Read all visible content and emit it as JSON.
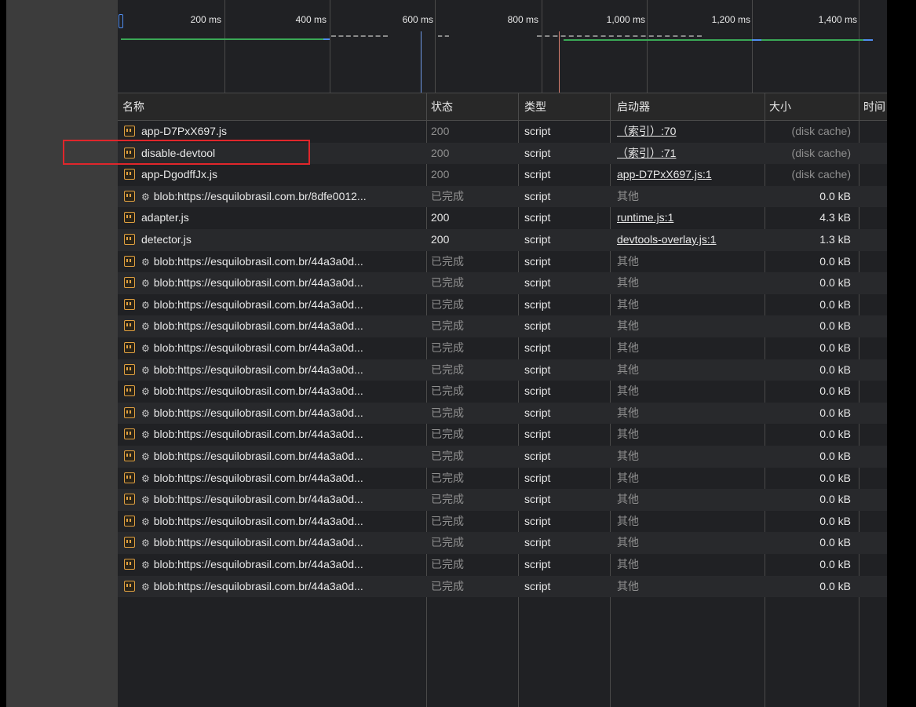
{
  "timeline": {
    "labels": [
      "200 ms",
      "400 ms",
      "600 ms",
      "800 ms",
      "1,000 ms",
      "1,200 ms",
      "1,400 ms"
    ]
  },
  "columns": {
    "name": "名称",
    "status": "状态",
    "type": "类型",
    "initiator": "启动器",
    "size": "大小",
    "time": "时间"
  },
  "rows": [
    {
      "name": "app-D7PxX697.js",
      "blob": false,
      "status": "200",
      "status_dim": true,
      "type": "script",
      "initiator": "（索引）:70",
      "initiator_link": true,
      "size": "(disk cache)",
      "size_dim": true
    },
    {
      "name": "disable-devtool",
      "blob": false,
      "status": "200",
      "status_dim": true,
      "type": "script",
      "initiator": "（索引）:71",
      "initiator_link": true,
      "size": "(disk cache)",
      "size_dim": true
    },
    {
      "name": "app-DgodffJx.js",
      "blob": false,
      "status": "200",
      "status_dim": true,
      "type": "script",
      "initiator": "app-D7PxX697.js:1",
      "initiator_link": true,
      "size": "(disk cache)",
      "size_dim": true
    },
    {
      "name": "blob:https://esquilobrasil.com.br/8dfe0012...",
      "blob": true,
      "status": "已完成",
      "status_dim": true,
      "type": "script",
      "initiator": "其他",
      "initiator_link": false,
      "size": "0.0 kB",
      "size_dim": false
    },
    {
      "name": "adapter.js",
      "blob": false,
      "status": "200",
      "status_dim": false,
      "type": "script",
      "initiator": "runtime.js:1",
      "initiator_link": true,
      "size": "4.3 kB",
      "size_dim": false
    },
    {
      "name": "detector.js",
      "blob": false,
      "status": "200",
      "status_dim": false,
      "type": "script",
      "initiator": "devtools-overlay.js:1",
      "initiator_link": true,
      "size": "1.3 kB",
      "size_dim": false
    },
    {
      "name": "blob:https://esquilobrasil.com.br/44a3a0d...",
      "blob": true,
      "status": "已完成",
      "status_dim": true,
      "type": "script",
      "initiator": "其他",
      "initiator_link": false,
      "size": "0.0 kB",
      "size_dim": false
    },
    {
      "name": "blob:https://esquilobrasil.com.br/44a3a0d...",
      "blob": true,
      "status": "已完成",
      "status_dim": true,
      "type": "script",
      "initiator": "其他",
      "initiator_link": false,
      "size": "0.0 kB",
      "size_dim": false
    },
    {
      "name": "blob:https://esquilobrasil.com.br/44a3a0d...",
      "blob": true,
      "status": "已完成",
      "status_dim": true,
      "type": "script",
      "initiator": "其他",
      "initiator_link": false,
      "size": "0.0 kB",
      "size_dim": false
    },
    {
      "name": "blob:https://esquilobrasil.com.br/44a3a0d...",
      "blob": true,
      "status": "已完成",
      "status_dim": true,
      "type": "script",
      "initiator": "其他",
      "initiator_link": false,
      "size": "0.0 kB",
      "size_dim": false
    },
    {
      "name": "blob:https://esquilobrasil.com.br/44a3a0d...",
      "blob": true,
      "status": "已完成",
      "status_dim": true,
      "type": "script",
      "initiator": "其他",
      "initiator_link": false,
      "size": "0.0 kB",
      "size_dim": false
    },
    {
      "name": "blob:https://esquilobrasil.com.br/44a3a0d...",
      "blob": true,
      "status": "已完成",
      "status_dim": true,
      "type": "script",
      "initiator": "其他",
      "initiator_link": false,
      "size": "0.0 kB",
      "size_dim": false
    },
    {
      "name": "blob:https://esquilobrasil.com.br/44a3a0d...",
      "blob": true,
      "status": "已完成",
      "status_dim": true,
      "type": "script",
      "initiator": "其他",
      "initiator_link": false,
      "size": "0.0 kB",
      "size_dim": false
    },
    {
      "name": "blob:https://esquilobrasil.com.br/44a3a0d...",
      "blob": true,
      "status": "已完成",
      "status_dim": true,
      "type": "script",
      "initiator": "其他",
      "initiator_link": false,
      "size": "0.0 kB",
      "size_dim": false
    },
    {
      "name": "blob:https://esquilobrasil.com.br/44a3a0d...",
      "blob": true,
      "status": "已完成",
      "status_dim": true,
      "type": "script",
      "initiator": "其他",
      "initiator_link": false,
      "size": "0.0 kB",
      "size_dim": false
    },
    {
      "name": "blob:https://esquilobrasil.com.br/44a3a0d...",
      "blob": true,
      "status": "已完成",
      "status_dim": true,
      "type": "script",
      "initiator": "其他",
      "initiator_link": false,
      "size": "0.0 kB",
      "size_dim": false
    },
    {
      "name": "blob:https://esquilobrasil.com.br/44a3a0d...",
      "blob": true,
      "status": "已完成",
      "status_dim": true,
      "type": "script",
      "initiator": "其他",
      "initiator_link": false,
      "size": "0.0 kB",
      "size_dim": false
    },
    {
      "name": "blob:https://esquilobrasil.com.br/44a3a0d...",
      "blob": true,
      "status": "已完成",
      "status_dim": true,
      "type": "script",
      "initiator": "其他",
      "initiator_link": false,
      "size": "0.0 kB",
      "size_dim": false
    },
    {
      "name": "blob:https://esquilobrasil.com.br/44a3a0d...",
      "blob": true,
      "status": "已完成",
      "status_dim": true,
      "type": "script",
      "initiator": "其他",
      "initiator_link": false,
      "size": "0.0 kB",
      "size_dim": false
    },
    {
      "name": "blob:https://esquilobrasil.com.br/44a3a0d...",
      "blob": true,
      "status": "已完成",
      "status_dim": true,
      "type": "script",
      "initiator": "其他",
      "initiator_link": false,
      "size": "0.0 kB",
      "size_dim": false
    },
    {
      "name": "blob:https://esquilobrasil.com.br/44a3a0d...",
      "blob": true,
      "status": "已完成",
      "status_dim": true,
      "type": "script",
      "initiator": "其他",
      "initiator_link": false,
      "size": "0.0 kB",
      "size_dim": false
    },
    {
      "name": "blob:https://esquilobrasil.com.br/44a3a0d...",
      "blob": true,
      "status": "已完成",
      "status_dim": true,
      "type": "script",
      "initiator": "其他",
      "initiator_link": false,
      "size": "0.0 kB",
      "size_dim": false
    }
  ],
  "icons": {
    "file": "script-file-icon",
    "blob": "gear-icon"
  },
  "colors": {
    "highlight": "#e0262b",
    "timeline_green": "#3aa856",
    "timeline_blue": "#4f8df0"
  }
}
